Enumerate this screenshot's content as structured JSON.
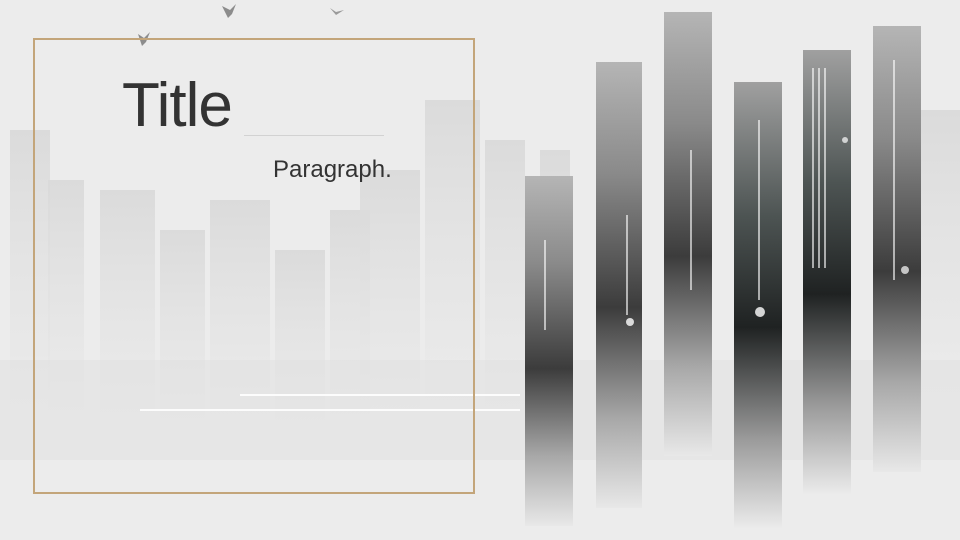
{
  "slide": {
    "title": "Title",
    "paragraph": "Paragraph.",
    "frame_color": "#c3a57a",
    "text_color": "#333333",
    "background_color": "#ececec"
  },
  "decor": {
    "icons": [
      "bird-icon",
      "cityscape-image"
    ]
  }
}
